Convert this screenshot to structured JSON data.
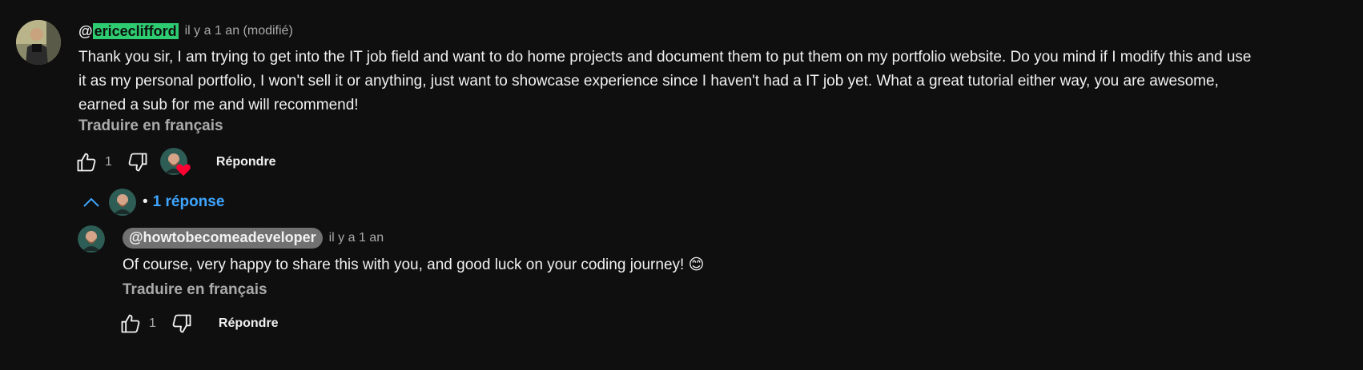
{
  "comment": {
    "author_prefix": "@",
    "author_highlight": "ericeclifford",
    "time": "il y a 1 an (modifié)",
    "text": "Thank you sir, I am trying to get into the IT job field and want to do home projects and document them to put them on my portfolio website. Do you mind if I modify this and use it as my personal portfolio, I won't sell it or anything, just want to showcase experience since I haven't had a IT job yet. What a great tutorial either way, you are awesome, earned a sub for me and will recommend!",
    "translate_label": "Traduire en français",
    "like_count": "1",
    "reply_label": "Répondre",
    "icons": [
      "thumb-up-icon",
      "thumb-down-icon",
      "creator-heart-icon"
    ],
    "accent_highlight": "#2ecc71",
    "heart_color": "#ff0033"
  },
  "replies_toggle": {
    "label": "1 réponse",
    "dot": "•",
    "icon": "chevron-up-icon",
    "color": "#3ea6ff"
  },
  "reply": {
    "author": "@howtobecomeadeveloper",
    "time": "il y a 1 an",
    "text": "Of course, very happy to share this with you, and good luck on your coding journey! 😊",
    "translate_label": "Traduire en français",
    "like_count": "1",
    "reply_label": "Répondre"
  }
}
